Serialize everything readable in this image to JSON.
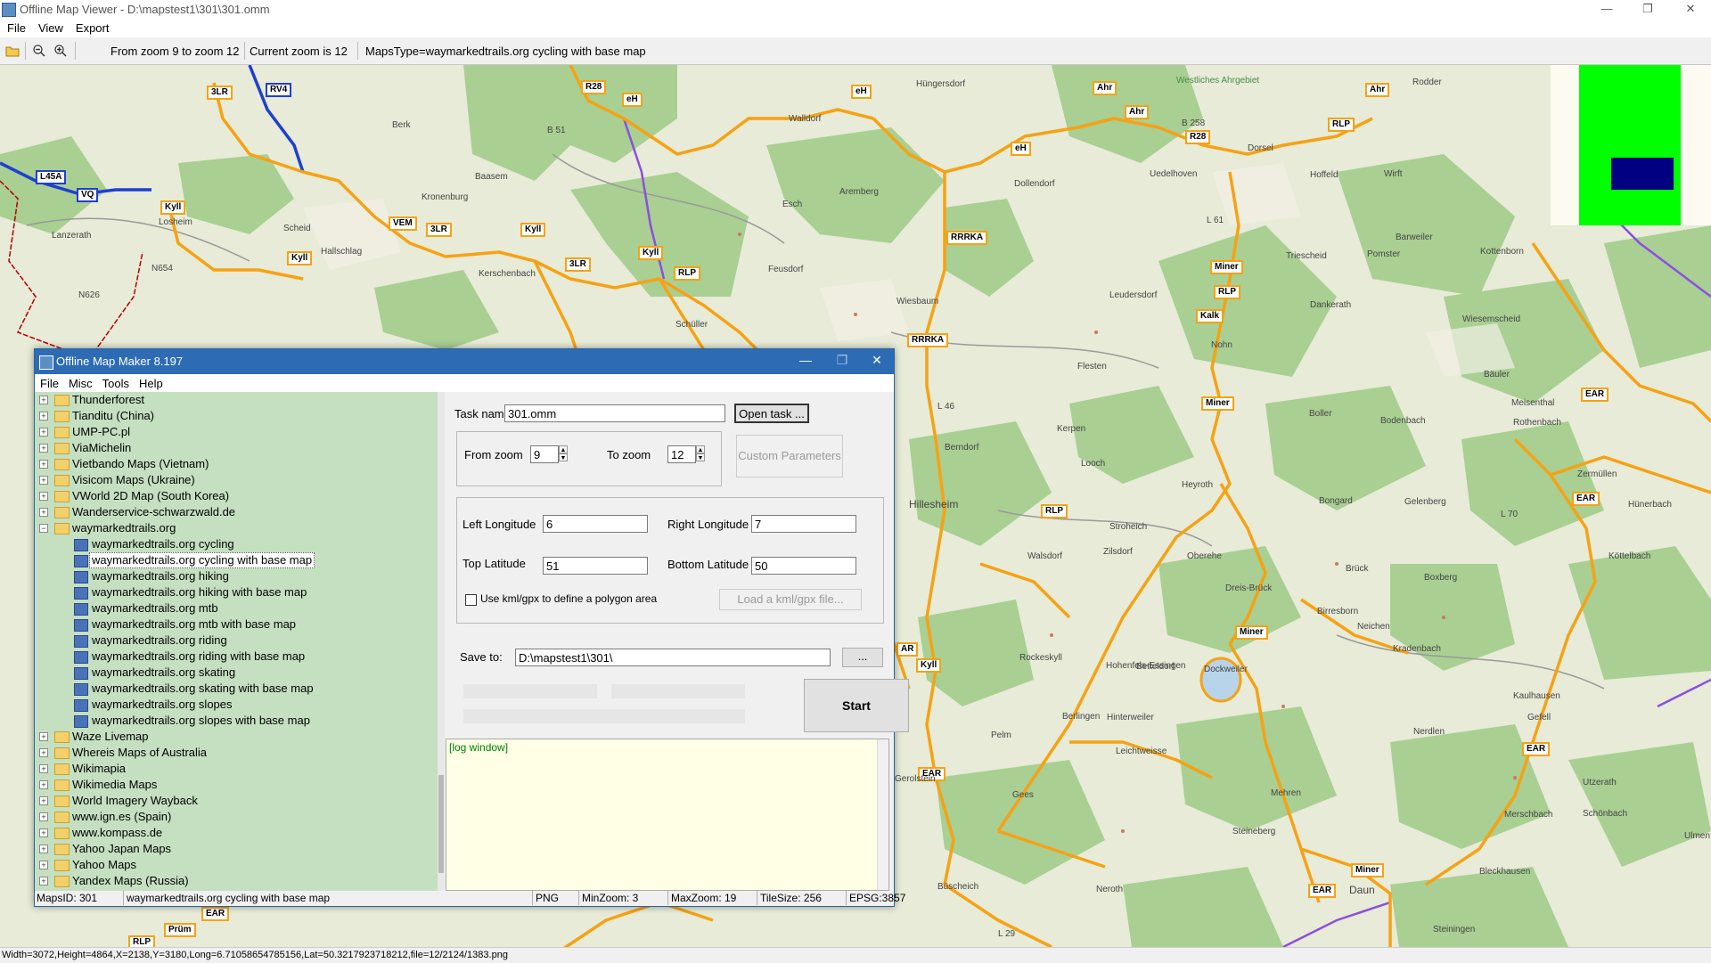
{
  "window": {
    "title": "Offline Map Viewer - D:\\mapstest1\\301\\301.omm",
    "minimize": "—",
    "maximize": "❐",
    "close": "✕"
  },
  "menu": [
    "File",
    "View",
    "Export"
  ],
  "toolbar": {
    "zoom_range": "From zoom 9 to zoom 12",
    "current_zoom": "Current zoom is 12",
    "maps_type": "MapsType=waymarkedtrails.org cycling with base map"
  },
  "map": {
    "route_labels": [
      "3LR",
      "RV4",
      "R28",
      "eH",
      "eH",
      "Ahr",
      "Ahr",
      "eH",
      "R28",
      "Ahr",
      "RLP",
      "L45A",
      "VQ",
      "Kyll",
      "VEM",
      "3LR",
      "Kyll",
      "Kyll",
      "3LR",
      "Kyll",
      "RLP",
      "RRRKA",
      "Miner",
      "RLP",
      "Kalk",
      "RRRKA",
      "Miner",
      "RLP",
      "Miner",
      "Kyll",
      "EAR",
      "EAR",
      "EAR",
      "EAR",
      "Miner",
      "EAR",
      "EAR",
      "Prüm",
      "RLP",
      "AR"
    ],
    "places": [
      "Rodder",
      "Hüngersdorf",
      "Westliches Ahrgebiet",
      "Berk",
      "Baasem",
      "B 51",
      "Walldorf",
      "Dorsel",
      "Hoffeld",
      "Uedelhoven",
      "Wirft",
      "Kronenburg",
      "Dollendorf",
      "Losheim",
      "Scheid",
      "Hallschlag",
      "Esch",
      "Aremberg",
      "Lanzerath",
      "N626",
      "Kerschenbach",
      "Feusdorf",
      "Wiesbaum",
      "Leudersdorf",
      "Barweiler",
      "Triescheid",
      "Pomster",
      "Dankerath",
      "Kottenborn",
      "Schüller",
      "Wiesemscheid",
      "Nohn",
      "Flesten",
      "Bäuler",
      "Meisenthal",
      "Boller",
      "Bodenbach",
      "Rothenbach",
      "Berndorf",
      "Kerpen",
      "Looch",
      "Heyroth",
      "Hillesheim",
      "Bongard",
      "Gelenberg",
      "Zermüllen",
      "Hünerbach",
      "Stroheich",
      "Walsdorf",
      "Zilsdorf",
      "Oberehe",
      "Brück",
      "Boxberg",
      "Köttelbach",
      "Dreis-Brück",
      "Neichen",
      "Birresborn",
      "Rockeskyll",
      "Kradenbach",
      "Betteldorf",
      "Dockweiler",
      "Kaulhausen",
      "Hohenfels-Essingen",
      "Berlingen",
      "Hinterweiler",
      "Nerdlen",
      "Gefell",
      "Daun",
      "Pelm",
      "Gees",
      "Mehren",
      "Steineberg",
      "Ulmen",
      "Neroth",
      "Utzerath",
      "Schönbach",
      "Büscheich",
      "Bleckhausen",
      "Steiningen",
      "Gerolstein",
      "Leichtweisse",
      "Merschbach",
      "L 70",
      "L 29",
      "L 46",
      "L 61",
      "B 258",
      "N654"
    ]
  },
  "dialog": {
    "title": "Offline Map Maker 8.197",
    "menu": [
      "File",
      "Misc",
      "Tools",
      "Help"
    ],
    "tree_top": [
      "Thunderforest",
      "Tianditu (China)",
      "UMP-PC.pl",
      "ViaMichelin",
      "Vietbando Maps (Vietnam)",
      "Visicom Maps (Ukraine)",
      "VWorld 2D Map (South Korea)",
      "Wanderservice-schwarzwald.de"
    ],
    "tree_open": "waymarkedtrails.org",
    "tree_children": [
      "waymarkedtrails.org cycling",
      "waymarkedtrails.org cycling with base map",
      "waymarkedtrails.org hiking",
      "waymarkedtrails.org hiking with base map",
      "waymarkedtrails.org mtb",
      "waymarkedtrails.org mtb with base map",
      "waymarkedtrails.org riding",
      "waymarkedtrails.org riding with base map",
      "waymarkedtrails.org skating",
      "waymarkedtrails.org skating with base map",
      "waymarkedtrails.org slopes",
      "waymarkedtrails.org slopes with base map"
    ],
    "tree_bottom": [
      "Waze Livemap",
      "Whereis Maps of Australia",
      "Wikimapia",
      "Wikimedia Maps",
      "World Imagery Wayback",
      "www.ign.es (Spain)",
      "www.kompass.de",
      "Yahoo Japan Maps",
      "Yahoo Maps",
      "Yandex Maps (Russia)"
    ],
    "task_name_label": "Task name",
    "task_name": "301.omm",
    "open_task": "Open task ...",
    "from_zoom_label": "From zoom",
    "from_zoom": "9",
    "to_zoom_label": "To zoom",
    "to_zoom": "12",
    "custom_params": "Custom Parameters",
    "left_lon_label": "Left Longitude",
    "left_lon": "6",
    "right_lon_label": "Right Longitude",
    "right_lon": "7",
    "top_lat_label": "Top Latitude",
    "top_lat": "51",
    "bottom_lat_label": "Bottom Latitude",
    "bottom_lat": "50",
    "use_kml_label": "Use kml/gpx to define a polygon area",
    "load_kml": "Load a kml/gpx file...",
    "save_to_label": "Save to:",
    "save_to": "D:\\mapstest1\\301\\",
    "browse": "...",
    "start": "Start",
    "log": "[log window]",
    "status": {
      "maps_id": "MapsID: 301",
      "name": "waymarkedtrails.org cycling with base map",
      "format": "PNG",
      "min_zoom": "MinZoom: 3",
      "max_zoom": "MaxZoom: 19",
      "tile_size": "TileSize: 256",
      "epsg": "EPSG:3857"
    }
  },
  "statusbar": "Width=3072,Height=4864,X=2138,Y=3180,Long=6.71058654785156,Lat=50.3217923718212,file=12/2124/1383.png",
  "colors": {
    "route": "#f5a214",
    "route_blue": "#1f3fd0",
    "forest": "#a9cf93",
    "dialog_title": "#2d6cb5",
    "tree_bg": "#c4e0c0"
  }
}
